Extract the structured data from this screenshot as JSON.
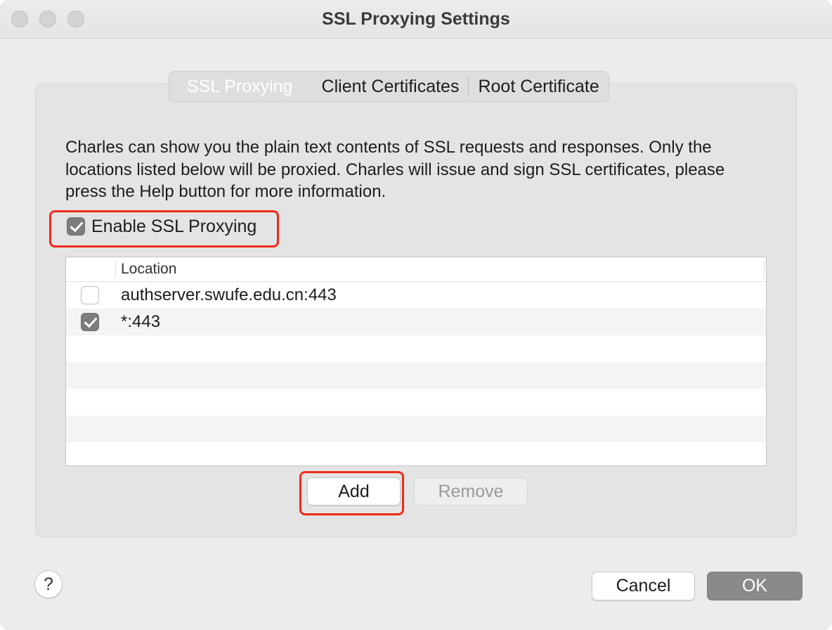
{
  "window": {
    "title": "SSL Proxying Settings"
  },
  "tabs": [
    {
      "label": "SSL Proxying",
      "active": true
    },
    {
      "label": "Client Certificates",
      "active": false
    },
    {
      "label": "Root Certificate",
      "active": false
    }
  ],
  "description": "Charles can show you the plain text contents of SSL requests and responses. Only the locations listed below will be proxied. Charles will issue and sign SSL certificates, please press the Help button for more information.",
  "enable_ssl": {
    "label": "Enable SSL Proxying",
    "checked": true
  },
  "table": {
    "column_header": "Location",
    "rows": [
      {
        "location": "authserver.swufe.edu.cn:443",
        "enabled": false
      },
      {
        "location": "*:443",
        "enabled": true
      }
    ]
  },
  "buttons": {
    "add": "Add",
    "remove": "Remove",
    "cancel": "Cancel",
    "ok": "OK",
    "help": "?"
  },
  "colors": {
    "highlight": "#ef2b1c",
    "window_bg": "#ececec"
  }
}
